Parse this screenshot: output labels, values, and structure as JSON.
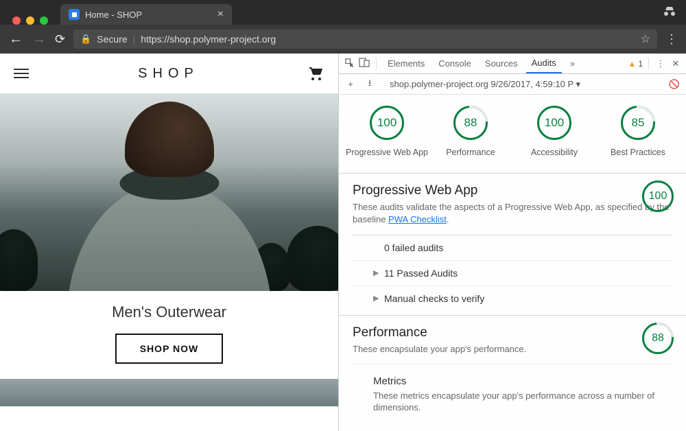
{
  "browser": {
    "tab_title": "Home - SHOP",
    "secure_label": "Secure",
    "url": "https://shop.polymer-project.org"
  },
  "page": {
    "logo": "SHOP",
    "category_title": "Men's Outerwear",
    "shop_now": "SHOP NOW"
  },
  "devtools": {
    "tabs": [
      "Elements",
      "Console",
      "Sources",
      "Audits"
    ],
    "active_tab": "Audits",
    "more_glyph": "»",
    "warn_count": "1",
    "audit_run_label": "shop.polymer-project.org 9/26/2017, 4:59:10 P",
    "scores": [
      {
        "value": "100",
        "label": "Progressive Web App",
        "partial": false
      },
      {
        "value": "88",
        "label": "Performance",
        "partial": true
      },
      {
        "value": "100",
        "label": "Accessibility",
        "partial": false
      },
      {
        "value": "85",
        "label": "Best Practices",
        "partial": true
      }
    ],
    "pwa_section": {
      "title": "Progressive Web App",
      "desc_prefix": "These audits validate the aspects of a Progressive Web App, as specified by the baseline ",
      "link_text": "PWA Checklist",
      "desc_suffix": ".",
      "score": "100",
      "rows": [
        {
          "label": "0 failed audits",
          "arrow": false
        },
        {
          "label": "11 Passed Audits",
          "arrow": true
        },
        {
          "label": "Manual checks to verify",
          "arrow": true
        }
      ]
    },
    "perf_section": {
      "title": "Performance",
      "desc": "These encapsulate your app's performance.",
      "score": "88",
      "metrics_title": "Metrics",
      "metrics_desc": "These metrics encapsulate your app's performance across a number of dimensions."
    }
  }
}
